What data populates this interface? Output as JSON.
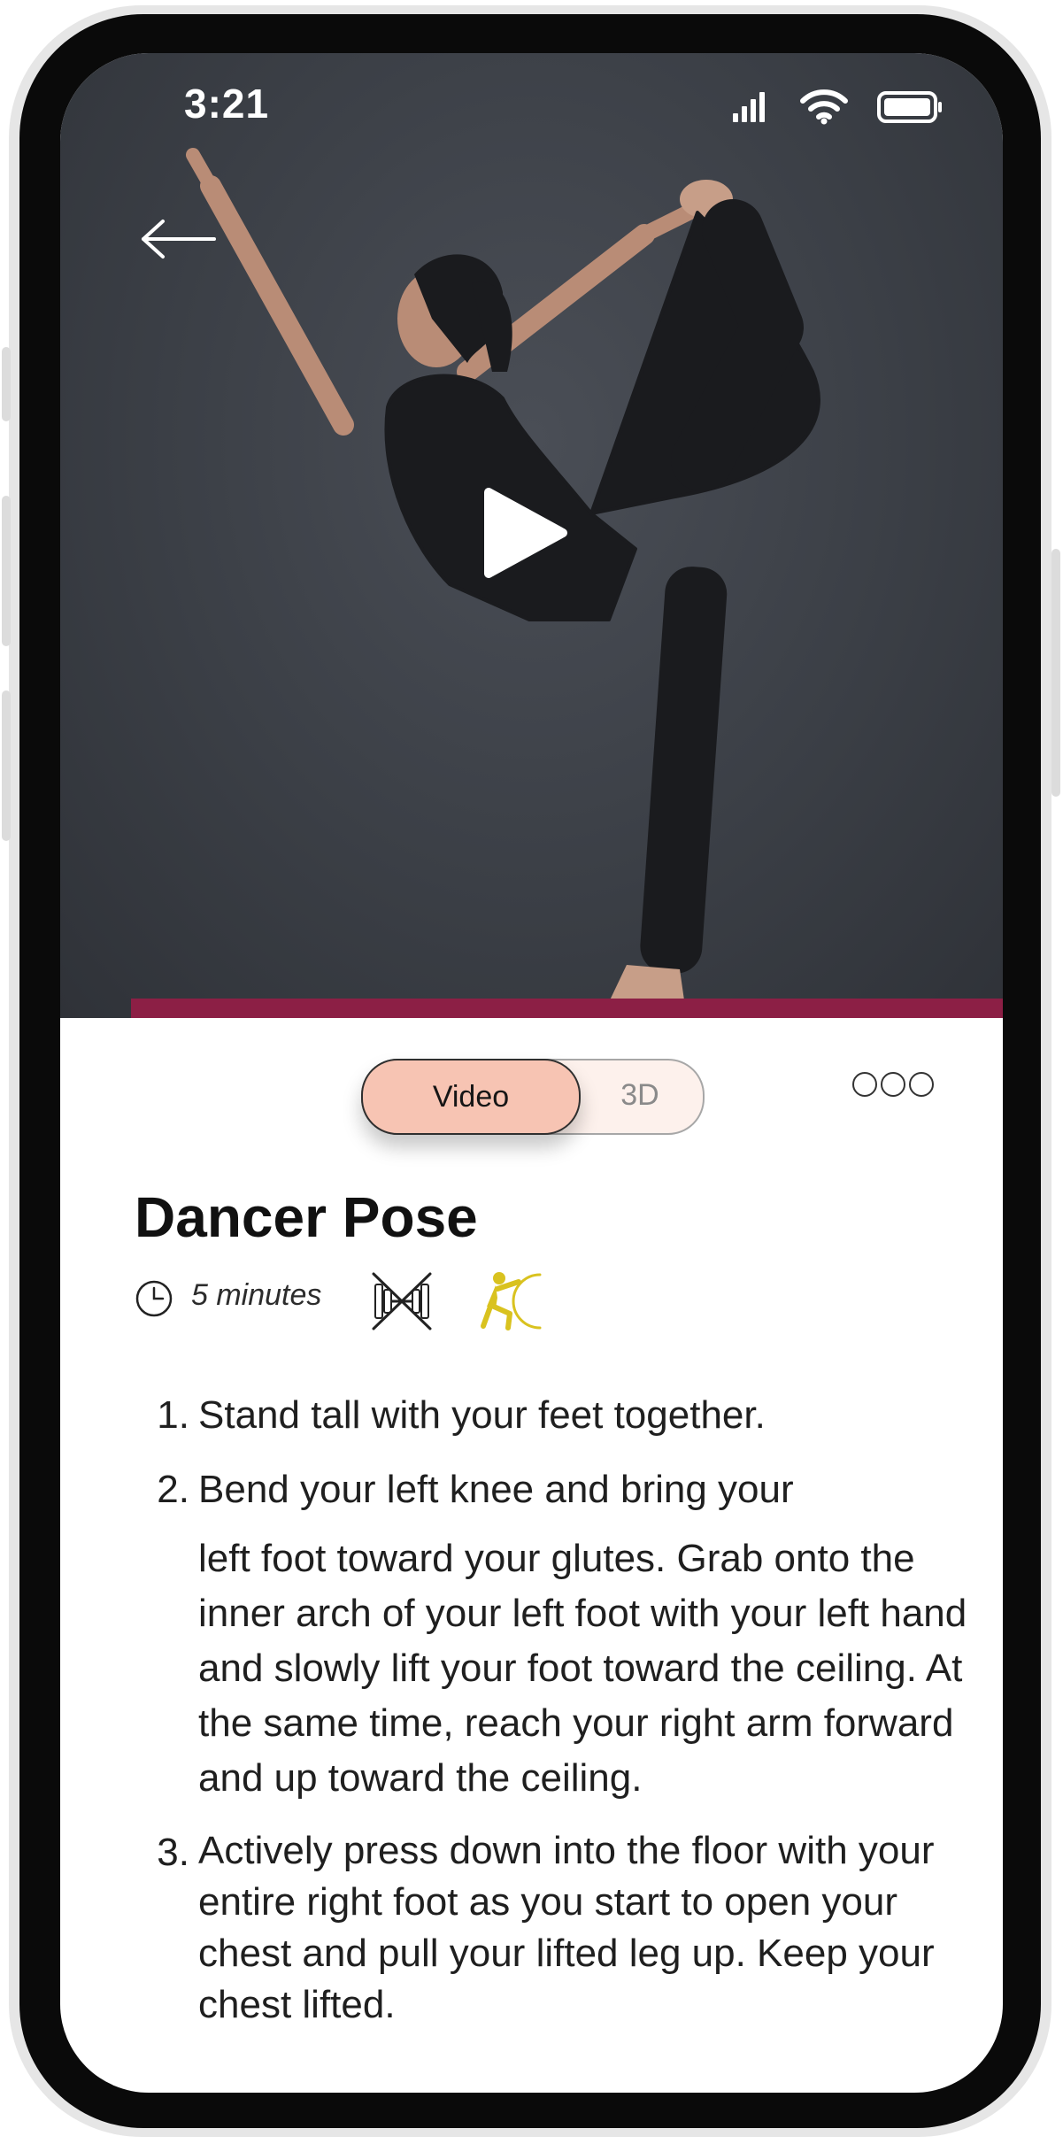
{
  "status_bar": {
    "time": "3:21"
  },
  "media": {
    "tabs": {
      "video": "Video",
      "three_d": "3D"
    }
  },
  "exercise": {
    "title": "Dancer Pose",
    "duration": "5 minutes",
    "steps": [
      {
        "number": "1.",
        "text": "Stand tall with your feet together."
      },
      {
        "number": "2.",
        "text_first": "Bend your left knee and bring your",
        "text_rest": "left foot toward your glutes. Grab onto the inner arch of your left foot with your left hand and slowly lift your foot toward the ceiling. At the same time, reach your right arm forward and up toward the ceiling."
      },
      {
        "number": "3.",
        "text": "Actively press down into the floor with your entire right foot as you start to open your chest and pull your lifted leg up. Keep your chest lifted."
      }
    ]
  },
  "colors": {
    "accent": "#f7c4b3",
    "tab_bg": "#fdf1ec",
    "stretch_icon": "#d9c21f",
    "mat": "#8c1f45",
    "hero_bg": "#3b3f46"
  },
  "icons": [
    "back-arrow-icon",
    "play-icon",
    "more-icon",
    "clock-icon",
    "no-equipment-icon",
    "stretch-icon",
    "signal-icon",
    "wifi-icon",
    "battery-icon"
  ]
}
